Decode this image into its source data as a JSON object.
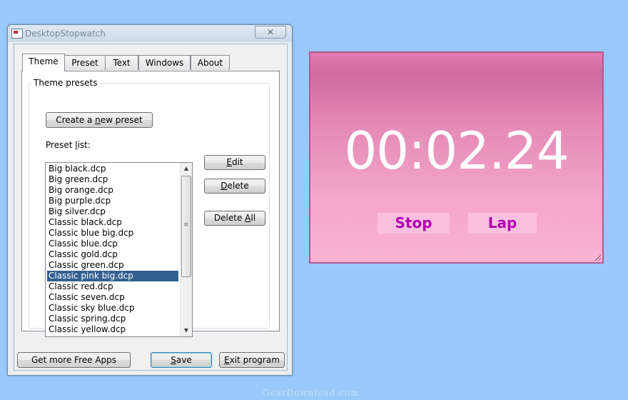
{
  "window": {
    "title": "DesktopStopwatch",
    "close_label": "✕"
  },
  "tabs": [
    "Theme",
    "Preset",
    "Text",
    "Windows",
    "About"
  ],
  "theme": {
    "group_label": "Theme presets",
    "create_button": {
      "pre": "Create a ",
      "u": "n",
      "post": "ew preset"
    },
    "list_label": {
      "pre": "Preset ",
      "u": "l",
      "post": "ist:"
    },
    "presets": [
      "Big black.dcp",
      "Big green.dcp",
      "Big orange.dcp",
      "Big purple.dcp",
      "Big silver.dcp",
      "Classic black.dcp",
      "Classic blue big.dcp",
      "Classic blue.dcp",
      "Classic gold.dcp",
      "Classic green.dcp",
      "Classic pink big.dcp",
      "Classic red.dcp",
      "Classic seven.dcp",
      "Classic sky blue.dcp",
      "Classic spring.dcp",
      "Classic yellow.dcp"
    ],
    "selected_preset": "Classic pink big.dcp",
    "edit_button": {
      "u": "E",
      "post": "dit"
    },
    "delete_button": {
      "u": "D",
      "post": "elete"
    },
    "delete_all_button": {
      "pre": "Delete ",
      "u": "A",
      "post": "ll"
    }
  },
  "footer": {
    "more_apps": "Get more Free Apps",
    "save": {
      "u": "S",
      "post": "ave"
    },
    "exit": {
      "u": "E",
      "post": "xit program"
    }
  },
  "stopwatch": {
    "time": "00:02.24",
    "stop_label": "Stop",
    "lap_label": "Lap",
    "colors": {
      "text": "#ffffff",
      "button_bg": "#fcbfe0",
      "button_text": "#b000b0",
      "border": "#b3588d"
    }
  },
  "watermark": "GearDownload.com",
  "icons": {
    "scroll_up": "▲",
    "scroll_down": "▼",
    "grip": "≡"
  }
}
